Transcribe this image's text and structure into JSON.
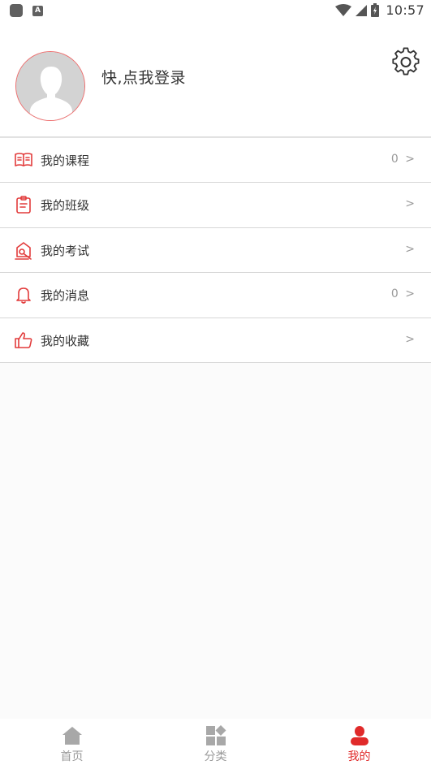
{
  "status_bar": {
    "time": "10:57",
    "icons": [
      "app-icon",
      "a-icon",
      "wifi-icon",
      "signal-icon",
      "battery-icon"
    ]
  },
  "profile": {
    "login_prompt": "快,点我登录",
    "avatar_icon": "default-avatar-icon",
    "settings_icon": "gear-icon"
  },
  "menu": {
    "items": [
      {
        "label": "我的课程",
        "right": "0 >",
        "icon": "book-icon"
      },
      {
        "label": "我的班级",
        "right": ">",
        "icon": "clipboard-icon"
      },
      {
        "label": "我的考试",
        "right": ">",
        "icon": "exam-icon"
      },
      {
        "label": "我的消息",
        "right": "0 >",
        "icon": "bell-icon"
      },
      {
        "label": "我的收藏",
        "right": ">",
        "icon": "thumbs-up-icon"
      }
    ]
  },
  "bottom_nav": {
    "items": [
      {
        "label": "首页",
        "icon": "home-icon",
        "active": false
      },
      {
        "label": "分类",
        "icon": "category-icon",
        "active": false
      },
      {
        "label": "我的",
        "icon": "user-icon",
        "active": true
      }
    ]
  },
  "colors": {
    "accent": "#e02a2a",
    "inactive": "#9a9a9a",
    "text": "#333333",
    "divider": "#d6d6d6"
  }
}
